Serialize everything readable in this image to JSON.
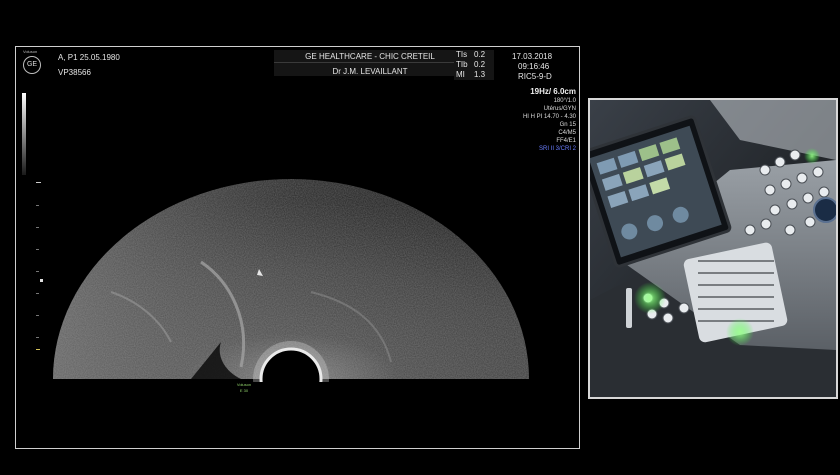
{
  "patient": {
    "id_line": "A, P1  25.05.1980",
    "record": "VP38566"
  },
  "institution": {
    "name": "GE HEALTHCARE - CHIC CRETEIL",
    "doctor": "Dr J.M. LEVAILLANT"
  },
  "indices": {
    "tis_label": "TIs",
    "tis_value": "0.2",
    "tib_label": "TIb",
    "tib_value": "0.2",
    "mi_label": "MI",
    "mi_value": "1.3"
  },
  "exam": {
    "date": "17.03.2018",
    "time": "09:16:46",
    "probe": "RIC5-9-D"
  },
  "params": {
    "frame_depth": "19Hz/ 6.0cm",
    "angle": "180°/1.0",
    "preset": "Utérus/GYN",
    "harmonics": "HI H PI 14.70 - 4.30",
    "gain": "Gn  15",
    "map": "C4/M5",
    "filter": "FF4/E1",
    "sri": "SRI II 3/CRI 2"
  },
  "logo": {
    "brand": "Voluson",
    "mark": "GE"
  },
  "probe_marker": {
    "line1": "Voluson",
    "line2": "E 30"
  },
  "colors": {
    "accent_blue": "#6a7dff",
    "probe_green": "#8fd06a",
    "frame_border": "#cfcfcf"
  }
}
